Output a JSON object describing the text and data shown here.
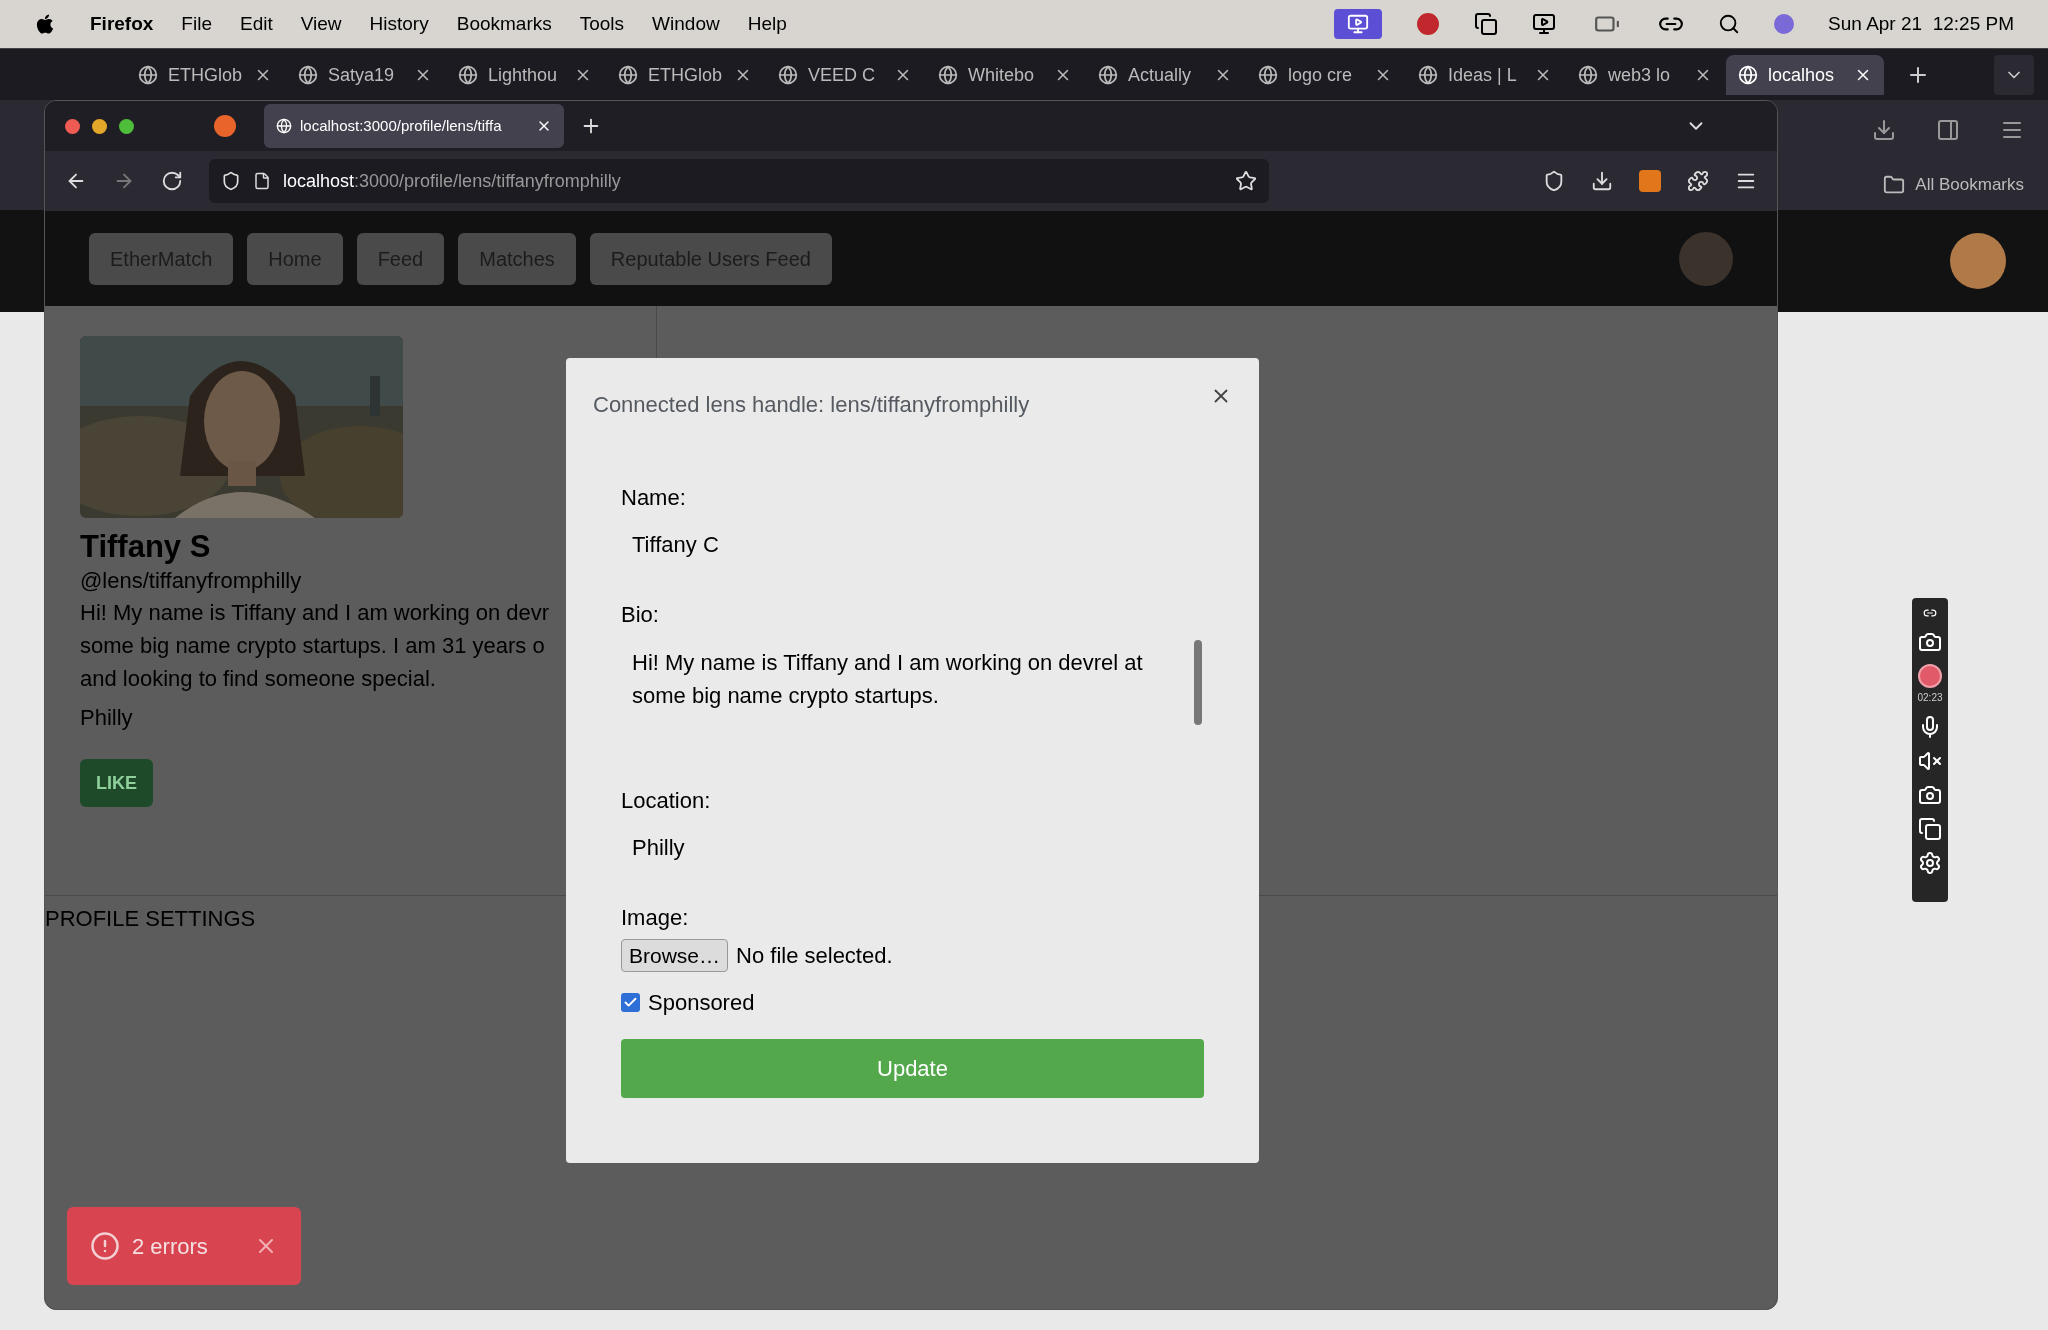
{
  "menu_bar": {
    "app": "Firefox",
    "menus": [
      "File",
      "Edit",
      "View",
      "History",
      "Bookmarks",
      "Tools",
      "Window",
      "Help"
    ],
    "clock": "Sun Apr 21  12:25 PM"
  },
  "back_window": {
    "tabs": [
      {
        "label": "ETHGlob",
        "selected": false
      },
      {
        "label": "Satya19",
        "selected": false
      },
      {
        "label": "Lighthou",
        "selected": false
      },
      {
        "label": "ETHGlob",
        "selected": false
      },
      {
        "label": "VEED C",
        "selected": false
      },
      {
        "label": "Whitebo",
        "selected": false
      },
      {
        "label": "Actually",
        "selected": false
      },
      {
        "label": "logo cre",
        "selected": false
      },
      {
        "label": "Ideas | L",
        "selected": false
      },
      {
        "label": "web3 lo",
        "selected": false
      },
      {
        "label": "localhos",
        "selected": true
      }
    ],
    "bookmarks": "All Bookmarks"
  },
  "browser": {
    "tab_title": "localhost:3000/profile/lens/tiffa",
    "url_host": "localhost",
    "url_path": ":3000/profile/lens/tiffanyfromphilly"
  },
  "nav": [
    {
      "label": "EtherMatch"
    },
    {
      "label": "Home"
    },
    {
      "label": "Feed"
    },
    {
      "label": "Matches"
    },
    {
      "label": "Reputable Users Feed"
    }
  ],
  "profile": {
    "name": "Tiffany S",
    "handle": "@lens/tiffanyfromphilly",
    "bio_lines": [
      "Hi! My name is Tiffany and I am working on devr",
      "some big name crypto startups. I am 31 years o",
      "and looking to find someone special."
    ],
    "location": "Philly",
    "like": "LIKE"
  },
  "settings_heading": "PROFILE SETTINGS",
  "modal": {
    "title": "Connected lens handle: lens/tiffanyfromphilly",
    "fields": [
      {
        "kind": "text",
        "label": "Name:",
        "value": "Tiffany C"
      },
      {
        "kind": "textarea",
        "label": "Bio:",
        "value": "Hi! My name is Tiffany and I am working on devrel at some big name crypto startups."
      },
      {
        "kind": "text",
        "label": "Location:",
        "value": "Philly"
      },
      {
        "kind": "file",
        "label": "Image:",
        "button": "Browse…",
        "status": "No file selected."
      }
    ],
    "sponsored": {
      "label": "Sponsored",
      "checked": true
    },
    "submit": "Update"
  },
  "toast": {
    "text": "2 errors"
  },
  "recorder": {
    "time": "02:23"
  }
}
